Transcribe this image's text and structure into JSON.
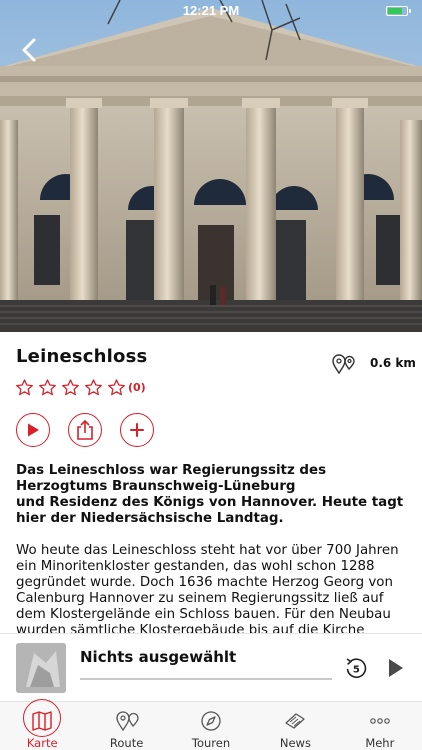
{
  "status_bar": {
    "time": "12:21 PM",
    "battery_level": 0.85,
    "battery_color": "#34c759"
  },
  "place": {
    "name": "Leineschloss",
    "distance": "0.6 km",
    "rating_count": "(0)",
    "stars_filled": 0,
    "stars_total": 5
  },
  "actions": {
    "play_icon": "play-icon",
    "share_icon": "share-icon",
    "add_icon": "plus-icon"
  },
  "description": {
    "lead_line1": "Das Leineschloss war Regierungssitz des Herzogtums Braunschweig-Lüneburg",
    "lead_line2": "und Residenz des Königs von Hannover. Heute tagt hier der Niedersächsische Landtag.",
    "body": "Wo heute das Leineschloss steht hat vor über 700 Jahren ein Minoritenkloster gestanden, das wohl schon 1288 gegründet wurde. Doch 1636 machte Herzog Georg von Calenburg Hannover zu seinem Regierungssitz ließ auf dem Klostergelände ein Schloss bauen. Für den Neubau wurden sämtliche Klostergebäude bis auf die Kirche abgerissen, die man schließlich zur Schlosskirche umbaute."
  },
  "player": {
    "title": "Nichts ausgewählt",
    "skip_seconds": "5",
    "progress": 0
  },
  "tabs": [
    {
      "label": "Karte",
      "icon": "map-icon",
      "active": true
    },
    {
      "label": "Route",
      "icon": "route-pins-icon",
      "active": false
    },
    {
      "label": "Touren",
      "icon": "compass-icon",
      "active": false
    },
    {
      "label": "News",
      "icon": "newspaper-icon",
      "active": false
    },
    {
      "label": "Mehr",
      "icon": "more-dots-icon",
      "active": false
    }
  ],
  "colors": {
    "accent": "#d81f2a",
    "tabbar_bg": "#f7f7f7"
  }
}
